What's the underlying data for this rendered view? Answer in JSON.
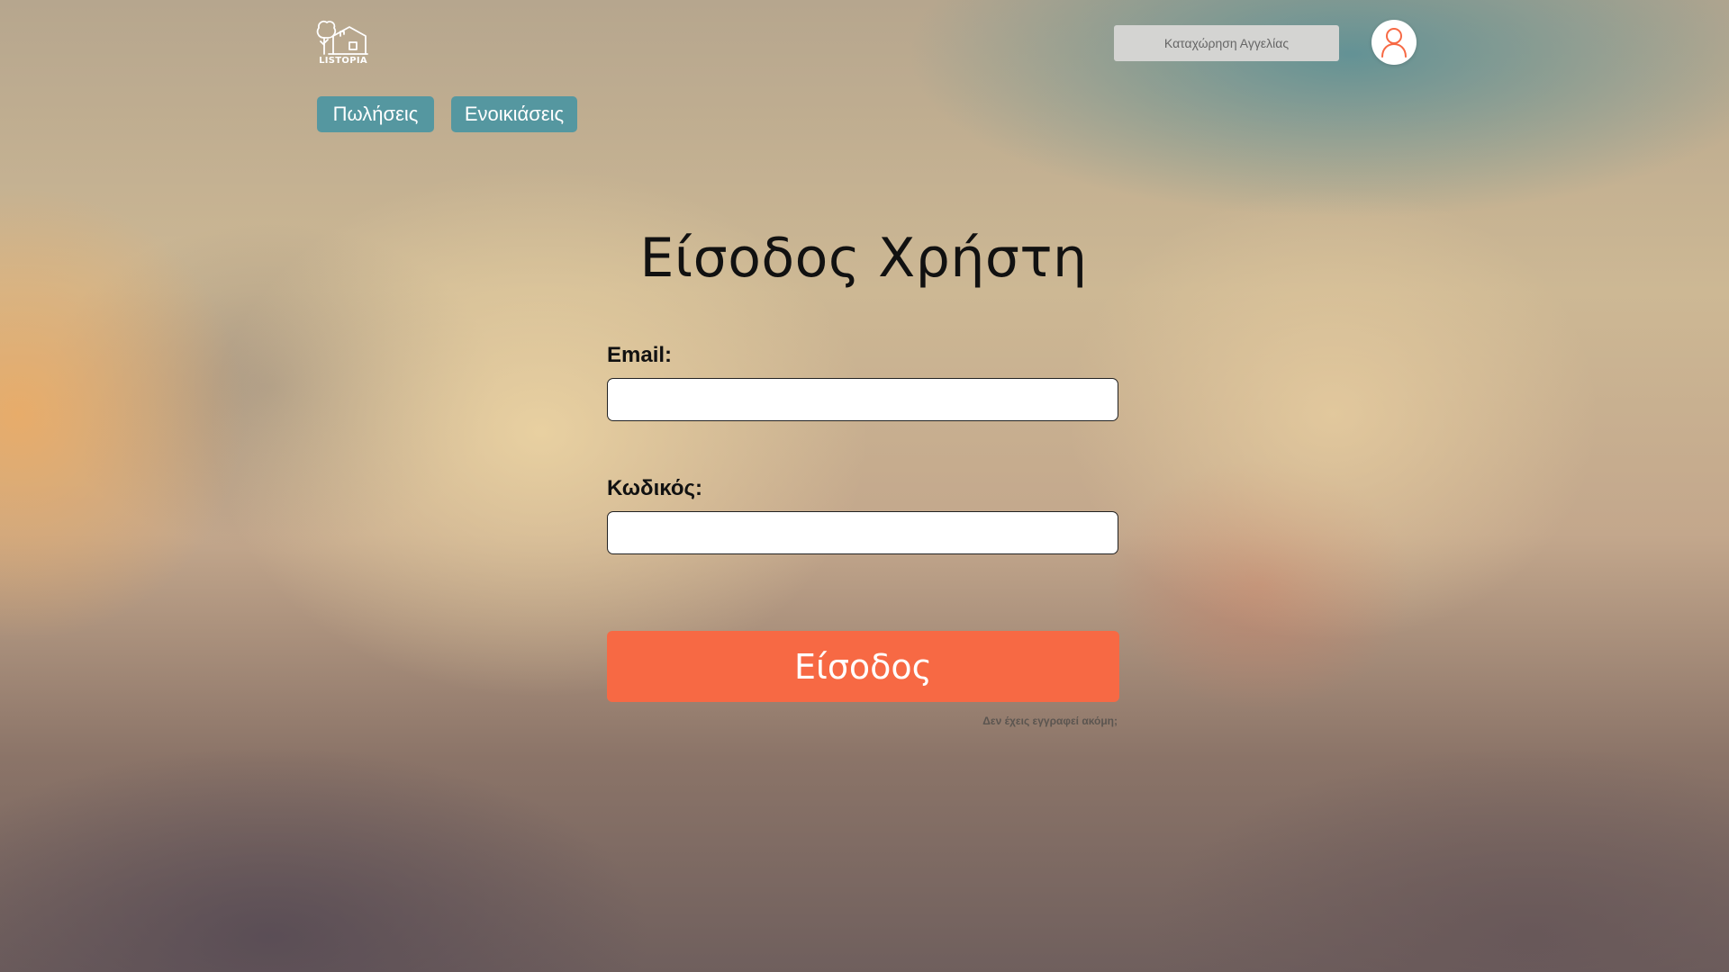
{
  "brand": {
    "logo_text": "LISTOPIA",
    "logo_icon": "house-with-tree-logo"
  },
  "header": {
    "listing_button_label": "Καταχώρηση Αγγελίας",
    "user_icon": "user-icon",
    "user_icon_color": "#f76944"
  },
  "nav": {
    "tabs": [
      {
        "label": "Πωλήσεις"
      },
      {
        "label": "Ενοικιάσεις"
      }
    ],
    "tab_color": "#5597a0"
  },
  "login": {
    "title": "Είσοδος Χρήστη",
    "email_label": "Email:",
    "email_value": "",
    "password_label": "Κωδικός:",
    "password_value": "",
    "submit_label": "Είσοδος",
    "submit_color": "#f76944",
    "register_prompt": "Δεν έχεις εγγραφεί ακόμη;"
  }
}
